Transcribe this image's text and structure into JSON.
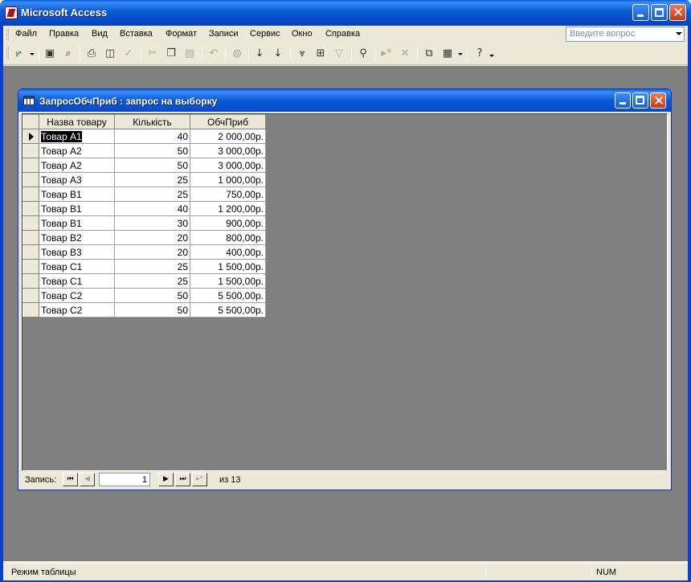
{
  "app": {
    "title": "Microsoft Access",
    "window_buttons": [
      "minimize-icon",
      "maximize-icon",
      "close-icon"
    ]
  },
  "menu": {
    "items": [
      "Файл",
      "Правка",
      "Вид",
      "Вставка",
      "Формат",
      "Записи",
      "Сервис",
      "Окно",
      "Справка"
    ],
    "help_placeholder": "Введите вопрос"
  },
  "toolbar": {
    "icons": [
      "view-design-icon",
      "save-icon",
      "search-file-icon",
      "print-icon",
      "print-preview-icon",
      "spelling-icon",
      "cut-icon",
      "copy-icon",
      "paste-icon",
      "undo-icon",
      "hyperlink-icon",
      "sort-ascending-icon",
      "sort-descending-icon",
      "filter-by-selection-icon",
      "filter-by-form-icon",
      "apply-filter-icon",
      "find-icon",
      "new-record-icon",
      "delete-record-icon",
      "database-window-icon",
      "new-object-icon",
      "help-icon"
    ]
  },
  "query_window": {
    "title": "ЗапросОбчПриб : запрос на выборку",
    "columns": [
      "Назва товару",
      "Кількість",
      "ОбчПриб"
    ],
    "rows": [
      [
        "Товар А1",
        "40",
        "2 000,00р."
      ],
      [
        "Товар А2",
        "50",
        "3 000,00р."
      ],
      [
        "Товар А2",
        "50",
        "3 000,00р."
      ],
      [
        "Товар А3",
        "25",
        "1 000,00р."
      ],
      [
        "Товар В1",
        "25",
        "750,00р."
      ],
      [
        "Товар В1",
        "40",
        "1 200,00р."
      ],
      [
        "Товар В1",
        "30",
        "900,00р."
      ],
      [
        "Товар В2",
        "20",
        "800,00р."
      ],
      [
        "Товар В3",
        "20",
        "400,00р."
      ],
      [
        "Товар С1",
        "25",
        "1 500,00р."
      ],
      [
        "Товар С1",
        "25",
        "1 500,00р."
      ],
      [
        "Товар С2",
        "50",
        "5 500,00р."
      ],
      [
        "Товар С2",
        "50",
        "5 500,00р."
      ]
    ],
    "current_row": 1
  },
  "navigation": {
    "label": "Запись:",
    "current": "1",
    "of_text": "из  13"
  },
  "status": {
    "mode": "Режим таблицы",
    "num": "NUM"
  }
}
